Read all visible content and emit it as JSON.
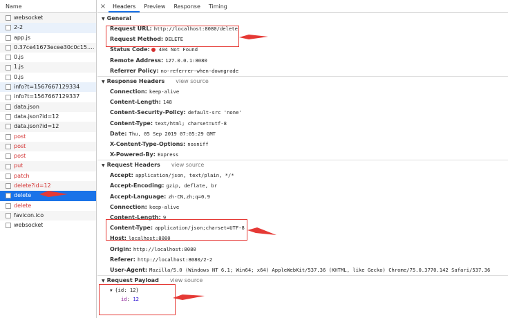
{
  "list": {
    "header": "Name",
    "items": [
      {
        "name": "websocket",
        "style": "alt"
      },
      {
        "name": "2-2",
        "style": "hl"
      },
      {
        "name": "app.js",
        "style": ""
      },
      {
        "name": "0.37ce41673ecee30c0c15.hot-...",
        "style": "alt"
      },
      {
        "name": "0.js",
        "style": ""
      },
      {
        "name": "1.js",
        "style": "alt"
      },
      {
        "name": "0.js",
        "style": ""
      },
      {
        "name": "info?t=1567667129334",
        "style": "hl"
      },
      {
        "name": "info?t=1567667129337",
        "style": ""
      },
      {
        "name": "data.json",
        "style": "alt"
      },
      {
        "name": "data.json?id=12",
        "style": ""
      },
      {
        "name": "data.json?id=12",
        "style": "alt"
      },
      {
        "name": "post",
        "style": "red"
      },
      {
        "name": "post",
        "style": "red alt"
      },
      {
        "name": "post",
        "style": "red"
      },
      {
        "name": "put",
        "style": "red alt"
      },
      {
        "name": "patch",
        "style": "red"
      },
      {
        "name": "delete?id=12",
        "style": "red alt"
      },
      {
        "name": "delete",
        "style": "sel"
      },
      {
        "name": "delete",
        "style": "red"
      },
      {
        "name": "favicon.ico",
        "style": "alt"
      },
      {
        "name": "websocket",
        "style": ""
      }
    ]
  },
  "tabs": {
    "close": "×",
    "items": [
      "Headers",
      "Preview",
      "Response",
      "Timing"
    ],
    "active": 0
  },
  "general": {
    "title": "General",
    "request_url_label": "Request URL:",
    "request_url": "http://localhost:8080/delete",
    "request_method_label": "Request Method:",
    "request_method": "DELETE",
    "status_code_label": "Status Code:",
    "status_code": "404 Not Found",
    "remote_address_label": "Remote Address:",
    "remote_address": "127.0.0.1:8080",
    "referrer_policy_label": "Referrer Policy:",
    "referrer_policy": "no-referrer-when-downgrade"
  },
  "response_headers": {
    "title": "Response Headers",
    "view_source": "view source",
    "rows": [
      {
        "k": "Connection:",
        "v": "keep-alive"
      },
      {
        "k": "Content-Length:",
        "v": "148"
      },
      {
        "k": "Content-Security-Policy:",
        "v": "default-src 'none'"
      },
      {
        "k": "Content-Type:",
        "v": "text/html; charset=utf-8"
      },
      {
        "k": "Date:",
        "v": "Thu, 05 Sep 2019 07:05:29 GMT"
      },
      {
        "k": "X-Content-Type-Options:",
        "v": "nosniff"
      },
      {
        "k": "X-Powered-By:",
        "v": "Express"
      }
    ]
  },
  "request_headers": {
    "title": "Request Headers",
    "view_source": "view source",
    "rows": [
      {
        "k": "Accept:",
        "v": "application/json, text/plain, */*"
      },
      {
        "k": "Accept-Encoding:",
        "v": "gzip, deflate, br"
      },
      {
        "k": "Accept-Language:",
        "v": "zh-CN,zh;q=0.9"
      },
      {
        "k": "Connection:",
        "v": "keep-alive"
      },
      {
        "k": "Content-Length:",
        "v": "9"
      },
      {
        "k": "Content-Type:",
        "v": "application/json;charset=UTF-8"
      },
      {
        "k": "Host:",
        "v": "localhost:8080"
      },
      {
        "k": "Origin:",
        "v": "http://localhost:8080"
      },
      {
        "k": "Referer:",
        "v": "http://localhost:8080/2-2"
      },
      {
        "k": "User-Agent:",
        "v": "Mozilla/5.0 (Windows NT 6.1; Win64; x64) AppleWebKit/537.36 (KHTML, like Gecko) Chrome/75.0.3770.142 Safari/537.36"
      }
    ]
  },
  "payload": {
    "title": "Request Payload",
    "view_source": "view source",
    "object": "{id: 12}",
    "key": "id",
    "value": "12"
  },
  "colors": {
    "accent": "#1a73e8",
    "annotation": "#e53935",
    "error": "#d32f2f"
  }
}
